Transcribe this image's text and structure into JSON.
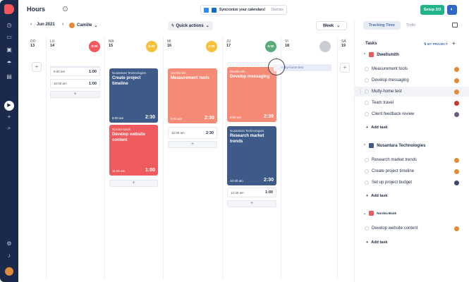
{
  "colors": {
    "sidebar": "#1b2a4a",
    "accent_green": "#21b48b",
    "card_blue": "#3d5a88",
    "card_salmon": "#f58a76",
    "card_red": "#ef5a5e",
    "brand_red": "#f0585c"
  },
  "app": {
    "title": "Hours",
    "info_icon": "info-icon"
  },
  "sidebar": {
    "icons": [
      "logo-icon",
      "clock-icon",
      "folder-icon",
      "image-icon",
      "umbrella-icon",
      "document-icon",
      "play-icon",
      "plus-icon",
      "search-icon",
      "settings-icon",
      "bell-icon"
    ],
    "play_glyph": "▶",
    "plus_glyph": "+",
    "search_glyph": "⌕"
  },
  "sync": {
    "text": "Syncronize your calendars!",
    "dismiss": "Dismiss"
  },
  "setup": {
    "label": "Setup 2/3"
  },
  "toolbar": {
    "prev": "‹",
    "next": "›",
    "month": "Jun 2021",
    "user": "Camille",
    "quick_actions": "Quick actions",
    "week": "Week",
    "chevron": "⌄"
  },
  "days": [
    {
      "abbr": "DO",
      "num": "13",
      "circle": ""
    },
    {
      "abbr": "LU",
      "num": "14",
      "circle": "0:00"
    },
    {
      "abbr": "MA",
      "num": "15",
      "circle": "5:30"
    },
    {
      "abbr": "MI",
      "num": "16",
      "circle": "2:30"
    },
    {
      "abbr": "JU",
      "num": "17",
      "circle": "6:00"
    },
    {
      "abbr": "VI",
      "num": "18",
      "circle": "-"
    },
    {
      "abbr": "SÁ",
      "num": "19",
      "circle": ""
    }
  ],
  "slots": {
    "s1_time": "9:00 am",
    "s1_dur": "1:00",
    "s2_time": "10:00 am",
    "s2_dur": "1:00",
    "mi_time": "12:00 am",
    "mi_dur": "2:30",
    "ju_time": "12:30 am",
    "ju_dur": "1:00"
  },
  "cards": {
    "c1": {
      "proj": "Nusantara Technologies",
      "name": "Create project timeline",
      "time": "8:00 am",
      "dur": "2:30"
    },
    "c2": {
      "proj": "Nordea Bank",
      "name": "Develop website content",
      "time": "11:00 am",
      "dur": "1:00"
    },
    "c3": {
      "proj": "Dwellsmith",
      "name": "Measurement tools",
      "time": "9:00 am",
      "dur": "2:30"
    },
    "c4": {
      "proj": "Dwellsmith",
      "name": "Develop messaging",
      "time": "8:00 am",
      "dur": "2:30"
    },
    "c5": {
      "proj": "Nusantara Technologies",
      "name": "Research market trends",
      "time": "10:30 am",
      "dur": "2:30"
    }
  },
  "drag": {
    "label": "Multy-home test"
  },
  "panel": {
    "tabs": [
      "Tracking Time",
      "Trello"
    ],
    "tasks_title": "Tasks",
    "by_project": "BY PROJECT",
    "add_task": "Add task",
    "groups": [
      {
        "name": "Dwellsmith",
        "color": "#f0585c",
        "tasks": [
          "Measurement tools",
          "Develop messaging",
          "Multy-home test",
          "Team travel",
          "Client feedback review"
        ]
      },
      {
        "name": "Nusantara Technologies",
        "color": "#3d5a88",
        "tasks": [
          "Research market trends",
          "Create project timeline",
          "Set up project budget"
        ]
      },
      {
        "name": "Nordea Bank",
        "color": "#ef5a5e",
        "tasks": [
          "Develop website content"
        ]
      }
    ]
  }
}
